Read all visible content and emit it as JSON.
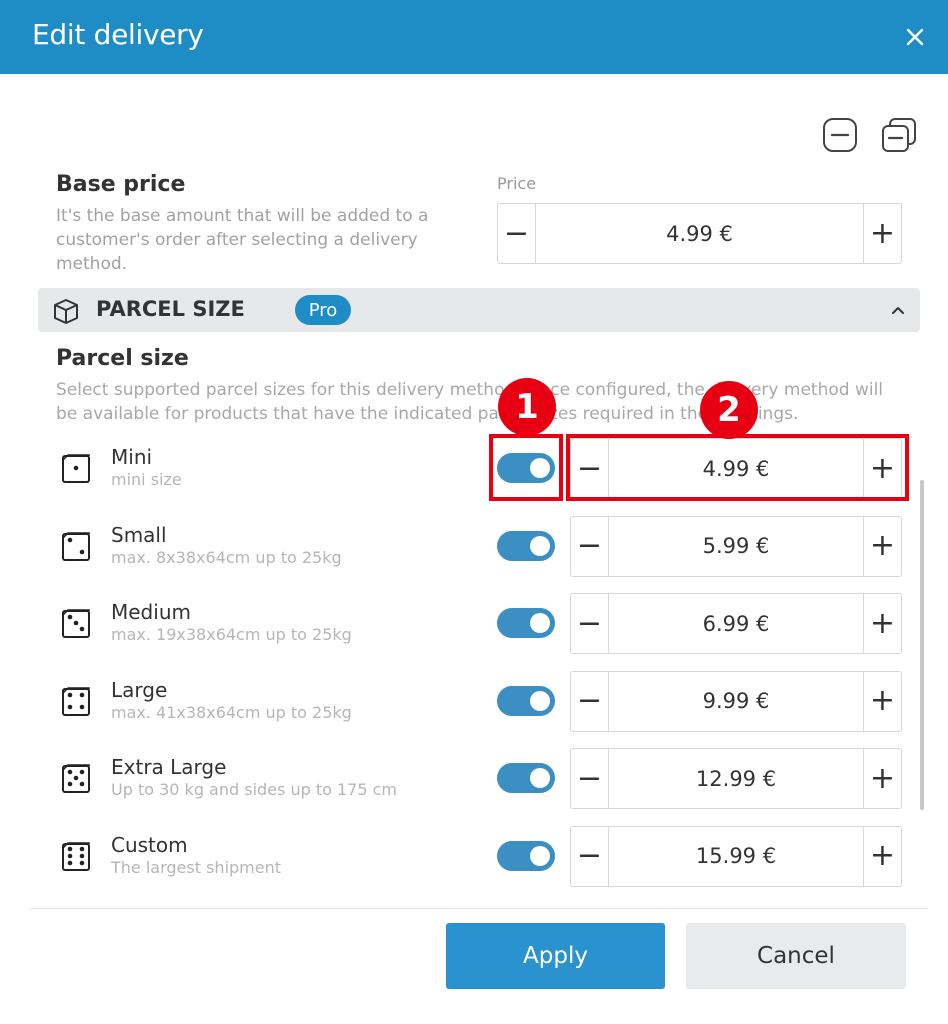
{
  "dialog": {
    "title": "Edit delivery",
    "close_icon": "close-icon"
  },
  "toolbar": {
    "collapse_icon": "collapse-all-icon",
    "copy_icon": "copy-icon"
  },
  "base_price": {
    "title": "Base price",
    "description": "It's the base amount that will be added to a customer's order after selecting a delivery method.",
    "price_label": "Price",
    "value": "4.99 €"
  },
  "parcel_section": {
    "title": "PARCEL SIZE",
    "badge": "Pro",
    "expanded": true,
    "heading": "Parcel size",
    "description": "Select supported parcel sizes for this delivery method. Once configured, the delivery method will be available for products that have the indicated parcel sizes required in their settings."
  },
  "parcel_sizes": [
    {
      "name": "Mini",
      "detail": "mini size",
      "enabled": true,
      "price": "4.99 €",
      "icon": "dice-1-icon"
    },
    {
      "name": "Small",
      "detail": "max. 8x38x64cm up to 25kg",
      "enabled": true,
      "price": "5.99 €",
      "icon": "dice-2-icon"
    },
    {
      "name": "Medium",
      "detail": "max. 19x38x64cm up to 25kg",
      "enabled": true,
      "price": "6.99 €",
      "icon": "dice-3-icon"
    },
    {
      "name": "Large",
      "detail": "max. 41x38x64cm up to 25kg",
      "enabled": true,
      "price": "9.99 €",
      "icon": "dice-4-icon"
    },
    {
      "name": "Extra Large",
      "detail": "Up to 30 kg and sides up to 175 cm",
      "enabled": true,
      "price": "12.99 €",
      "icon": "dice-5-icon"
    },
    {
      "name": "Custom",
      "detail": "The largest shipment",
      "enabled": true,
      "price": "15.99 €",
      "icon": "dice-6-icon"
    }
  ],
  "annotations": {
    "marker_1": "1",
    "marker_2": "2",
    "color": "#e60012"
  },
  "footer": {
    "apply_label": "Apply",
    "cancel_label": "Cancel"
  },
  "colors": {
    "header": "#1f8dc5",
    "toggle_on": "#3b8fc3",
    "apply_button": "#2a92cf",
    "section_bar": "#e6e8ea"
  }
}
